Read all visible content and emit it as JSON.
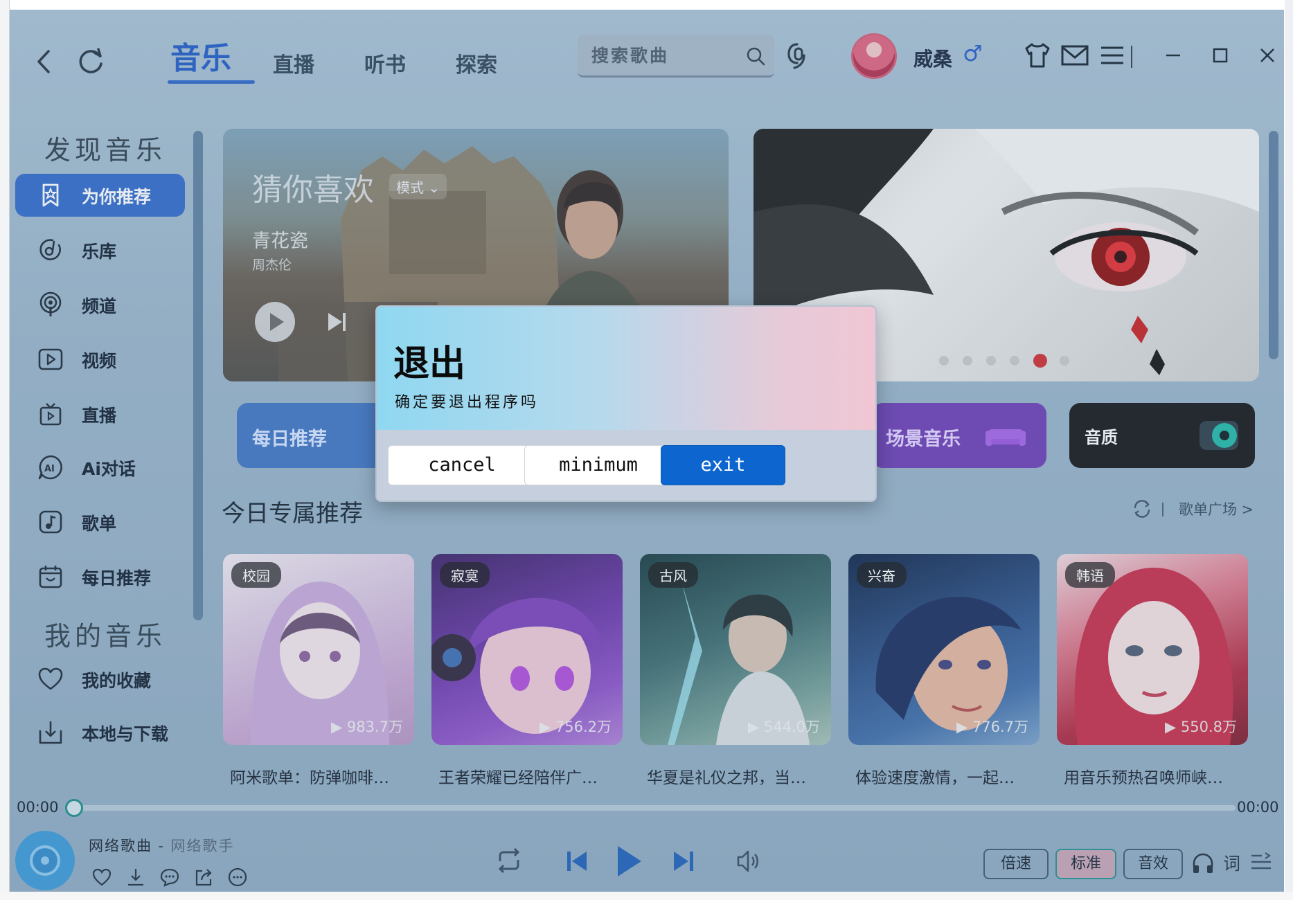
{
  "topbar": {
    "tabs": [
      {
        "label": "音乐",
        "active": true
      },
      {
        "label": "直播"
      },
      {
        "label": "听书"
      },
      {
        "label": "探索"
      }
    ],
    "search_placeholder": "搜索歌曲",
    "username": "威桑",
    "gender_symbol": "♂"
  },
  "sidebar": {
    "discover_heading": "发现音乐",
    "my_heading": "我的音乐",
    "items": [
      {
        "label": "为你推荐",
        "icon": "star-bookmark-icon",
        "active": true
      },
      {
        "label": "乐库",
        "icon": "music-disc-icon"
      },
      {
        "label": "频道",
        "icon": "podcast-icon"
      },
      {
        "label": "视频",
        "icon": "video-icon"
      },
      {
        "label": "直播",
        "icon": "tv-icon"
      },
      {
        "label": "Ai对话",
        "icon": "ai-chat-icon"
      },
      {
        "label": "歌单",
        "icon": "playlist-icon"
      },
      {
        "label": "每日推荐",
        "icon": "calendar-icon"
      }
    ],
    "my_items": [
      {
        "label": "我的收藏",
        "icon": "heart-icon"
      },
      {
        "label": "本地与下载",
        "icon": "download-icon"
      }
    ]
  },
  "banner": {
    "title": "猜你喜欢",
    "mode_label": "模式",
    "song": "青花瓷",
    "artist": "周杰伦"
  },
  "quick_cards": {
    "daily": "每日推荐",
    "scene": "场景音乐",
    "quality": "音质"
  },
  "section": {
    "title": "今日专属推荐",
    "link": "歌单广场 >"
  },
  "playlists": [
    {
      "tag": "校园",
      "plays": "983.7万",
      "caption": "阿米歌单：防弹咖啡…",
      "color": "#d9b8df"
    },
    {
      "tag": "寂寞",
      "plays": "756.2万",
      "caption": "王者荣耀已经陪伴广…",
      "color": "#6a35a8"
    },
    {
      "tag": "古风",
      "plays": "544.0万",
      "caption": "华夏是礼仪之邦，当…",
      "color": "#3c6b6e"
    },
    {
      "tag": "兴奋",
      "plays": "776.7万",
      "caption": "体验速度激情，一起…",
      "color": "#2a4f86"
    },
    {
      "tag": "韩语",
      "plays": "550.8万",
      "caption": "用音乐预热召唤师峡…",
      "color": "#b3283f"
    }
  ],
  "player": {
    "time_current": "00:00",
    "time_total": "00:00",
    "progress": 0,
    "song": "网络歌曲",
    "separator": " - ",
    "artist": "网络歌手",
    "pills": [
      {
        "label": "倍速"
      },
      {
        "label": "标准",
        "active": true
      },
      {
        "label": "音效"
      }
    ],
    "lyric_label": "词"
  },
  "modal": {
    "title": "退出",
    "message": "确定要退出程序吗",
    "buttons": {
      "cancel": "cancel",
      "minimum": "minimum",
      "exit": "exit"
    }
  },
  "colors": {
    "accent": "#2f68c8",
    "exit_button": "#0d66cf",
    "scene_card": "#6b3bb4",
    "daily_card": "#3d73c2"
  }
}
